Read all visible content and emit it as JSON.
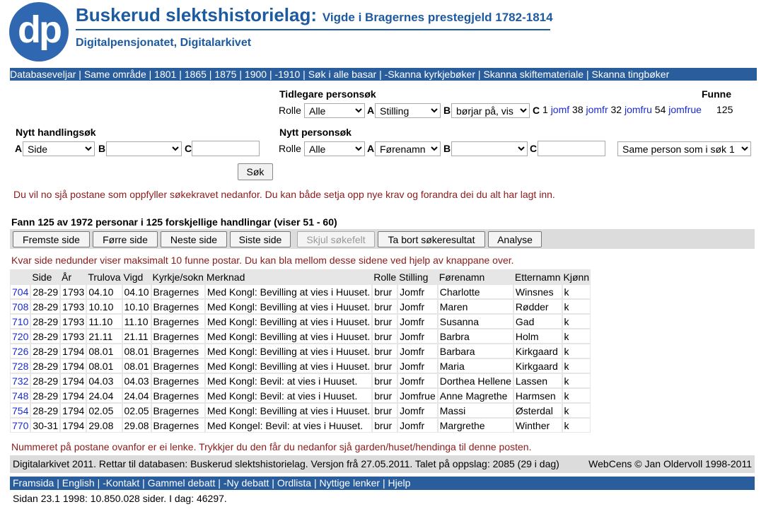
{
  "header": {
    "logo_text": "dp",
    "title": "Buskerud slektshistorielag:",
    "title_sub": "Vigde i Bragernes prestegjeld 1782-1814",
    "subtitle": "Digitalpensjonatet, Digitalarkivet"
  },
  "topnav": [
    "Databaseveljar",
    "Same område",
    "1801",
    "1865",
    "1875",
    "1900",
    "-1910",
    "Søk i alle basar",
    "-Skanna kyrkjebøker",
    "Skanna skiftemateriale",
    "Skanna tingbøker"
  ],
  "prev_search": {
    "heading": "Tidlegare personsøk",
    "rolle_label": "Rolle",
    "rolle_value": "Alle",
    "a_label": "A",
    "a_value": "Stilling",
    "b_label": "B",
    "b_value": "børjar på, vis",
    "c_label": "C",
    "results": [
      {
        "count": "1",
        "word": "jomf"
      },
      {
        "count": "38",
        "word": "jomfr"
      },
      {
        "count": "32",
        "word": "jomfru"
      },
      {
        "count": "54",
        "word": "jomfrue"
      }
    ],
    "funne_label": "Funne",
    "funne_value": "125"
  },
  "action_search": {
    "heading": "Nytt handlingsøk",
    "a_label": "A",
    "a_value": "Side",
    "b_label": "B",
    "b_value": "",
    "c_label": "C",
    "c_value": ""
  },
  "new_search": {
    "heading": "Nytt personsøk",
    "rolle_label": "Rolle",
    "rolle_value": "Alle",
    "a_label": "A",
    "a_value": "Førenamn",
    "b_label": "B",
    "b_value": "",
    "c_label": "C",
    "c_value": "",
    "same_value": "Same person som i søk 1"
  },
  "sok_button": "Søk",
  "info_message": "Du vil no sjå postane som oppfyller søkekravet nedanfor. Du kan både setja opp nye krav og forandra dei du alt har lagt inn.",
  "results_summary": "Fann 125 av 1972 personar i 125 forskjellige handlingar (viser 51 - 60)",
  "buttons": [
    "Fremste side",
    "Førre side",
    "Neste side",
    "Siste side",
    "Skjul søkefelt",
    "Ta bort søkeresultat",
    "Analyse"
  ],
  "page_info": "Kvar side nedunder viser maksimalt 10 funne postar. Du kan bla mellom desse sidene ved hjelp av knappane over.",
  "table": {
    "headers": [
      "",
      "Side",
      "År",
      "Trulova",
      "Vigd",
      "Kyrkje/sokn",
      "Merknad",
      "Rolle",
      "Stilling",
      "Førenamn",
      "Etternamn",
      "Kjønn"
    ],
    "rows": [
      [
        "704",
        "28-29",
        "1793",
        "04.10",
        "04.10",
        "Bragernes",
        "Med Kongl: Bevilling at vies i Huuset.",
        "brur",
        "Jomfr",
        "Charlotte",
        "Winsnes",
        "k"
      ],
      [
        "708",
        "28-29",
        "1793",
        "10.10",
        "10.10",
        "Bragernes",
        "Med Kongl: Bevilling at vies i Huuset.",
        "brur",
        "Jomfr",
        "Maren",
        "Rødder",
        "k"
      ],
      [
        "710",
        "28-29",
        "1793",
        "11.10",
        "11.10",
        "Bragernes",
        "Med Kongl: Bevilling at vies i Huuset.",
        "brur",
        "Jomfr",
        "Susanna",
        "Gad",
        "k"
      ],
      [
        "720",
        "28-29",
        "1793",
        "21.11",
        "21.11",
        "Bragernes",
        "Med Kongl: Bevilling at vies i Huuset.",
        "brur",
        "Jomfr",
        "Barbra",
        "Holm",
        "k"
      ],
      [
        "726",
        "28-29",
        "1794",
        "08.01",
        "08.01",
        "Bragernes",
        "Med Kongl: Bevilling at vies i Huuset.",
        "brur",
        "Jomfr",
        "Barbara",
        "Kirkgaard",
        "k"
      ],
      [
        "728",
        "28-29",
        "1794",
        "08.01",
        "08.01",
        "Bragernes",
        "Med Kongl: Bevilling at vies i Huuset.",
        "brur",
        "Jomfr",
        "Maria",
        "Kirkgaard",
        "k"
      ],
      [
        "732",
        "28-29",
        "1794",
        "04.03",
        "04.03",
        "Bragernes",
        "Med Kongl: Bevil: at vies i Huuset.",
        "brur",
        "Jomfr",
        "Dorthea Hellene",
        "Lassen",
        "k"
      ],
      [
        "748",
        "28-29",
        "1794",
        "24.04",
        "24.04",
        "Bragernes",
        "Med Kongl: Bevil: at vies i Huuset.",
        "brur",
        "Jomfrue",
        "Anne Magrethe",
        "Harmsen",
        "k"
      ],
      [
        "754",
        "28-29",
        "1794",
        "02.05",
        "02.05",
        "Bragernes",
        "Med Kongl: Bevilling at vies i Huuset.",
        "brur",
        "Jomfr",
        "Massi",
        "Østerdal",
        "k"
      ],
      [
        "770",
        "30-31",
        "1794",
        "29.08",
        "29.08",
        "Bragernes",
        "Med Kongel: Bevil: at vies i Huuset.",
        "brur",
        "Jomfr",
        "Margrethe",
        "Winther",
        "k"
      ]
    ]
  },
  "link_note": "Nummeret på postane ovanfor er ei lenke. Trykkjer du den får du nedanfor sjå garden/huset/hendinga til denne posten.",
  "footer": {
    "left": "Digitalarkivet 2011. Rettar til databasen: Buskerud slektshistorielag. Versjon frå 27.05.2011. Talet på oppslag: 2085 (29 i dag)",
    "right": "WebCens © Jan Oldervoll 1998-2011"
  },
  "botnav": [
    "Framsida",
    "English",
    "-Kontakt",
    "Gammel debatt",
    "-Ny debatt",
    "Ordlista",
    "Nyttige lenker",
    "Hjelp"
  ],
  "counter": "Sidan 23.1 1998: 10.850.028 sider. I dag: 46297."
}
